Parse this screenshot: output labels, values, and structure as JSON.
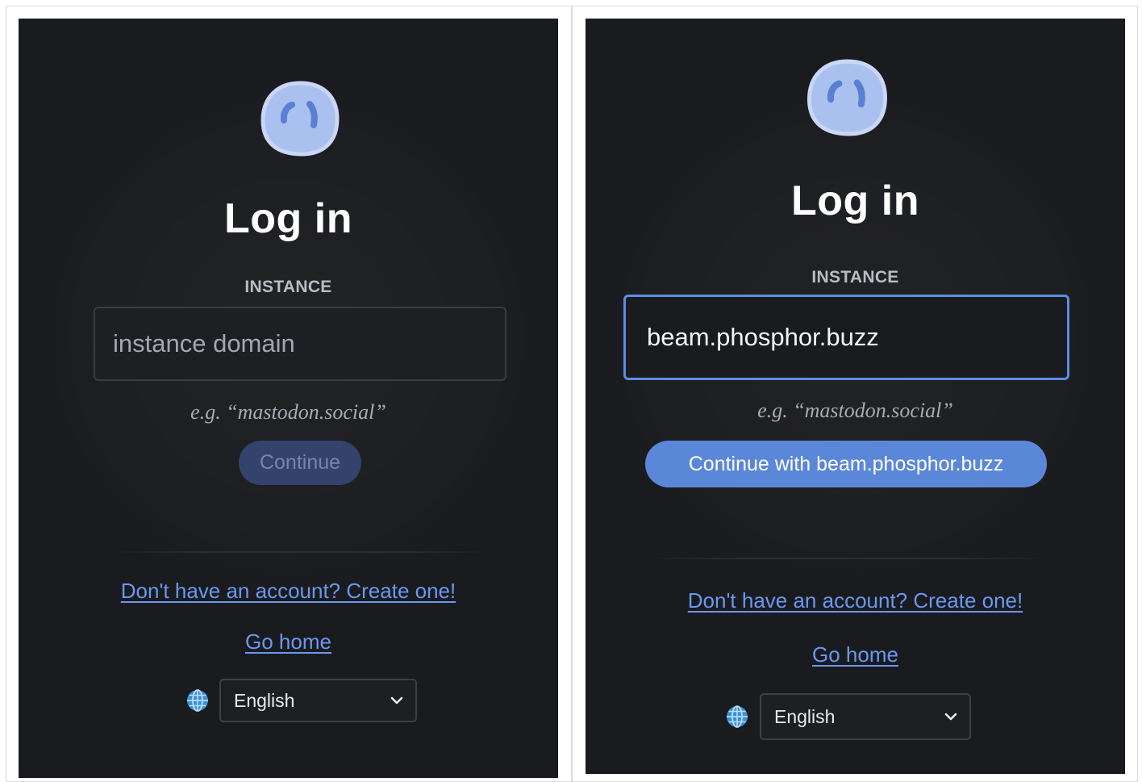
{
  "panels": [
    {
      "title": "Log in",
      "instance_label": "INSTANCE",
      "input": {
        "value": "",
        "placeholder": "instance domain"
      },
      "hint": "e.g. “mastodon.social”",
      "continue_button": "Continue",
      "signup_link": "Don't have an account? Create one!",
      "home_link": "Go home",
      "language": "English"
    },
    {
      "title": "Log in",
      "instance_label": "INSTANCE",
      "input": {
        "value": "beam.phosphor.buzz",
        "placeholder": "instance domain"
      },
      "hint": "e.g. “mastodon.social”",
      "continue_button": "Continue with beam.phosphor.buzz",
      "signup_link": "Don't have an account? Create one!",
      "home_link": "Go home",
      "language": "English"
    }
  ],
  "colors": {
    "background": "#1a1b1e",
    "accent": "#5b87d8",
    "link": "#6a98f0",
    "disabled_button": "#33436b"
  },
  "icons": [
    "mastodon-logo",
    "globe-icon",
    "chevron-down-icon"
  ]
}
